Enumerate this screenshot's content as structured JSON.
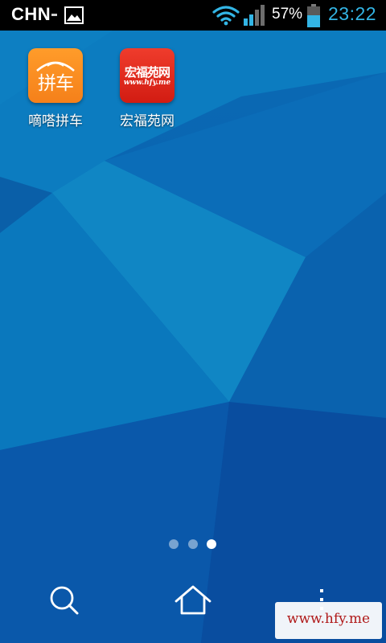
{
  "status_bar": {
    "carrier": "CHN",
    "battery_percent": "57%",
    "battery_level": 0.57,
    "time": "23:22",
    "icons": [
      "gallery-icon",
      "wifi-icon",
      "signal-icon",
      "battery-icon"
    ],
    "clock_color": "#33b5e5"
  },
  "apps": [
    {
      "label": "嘀嗒拼车",
      "icon_text": "拼车",
      "icon_color": "#f5801a"
    },
    {
      "label": "宏福苑网",
      "icon_text": "宏福苑网",
      "icon_subtext": "www.hfy.me",
      "icon_color": "#d21c12"
    }
  ],
  "page_indicator": {
    "total_pages": 3,
    "current_page": 3
  },
  "dock": {
    "icons": [
      "search-icon",
      "home-icon",
      "menu-icon"
    ]
  },
  "watermark": {
    "text": "www.hfy.me"
  }
}
